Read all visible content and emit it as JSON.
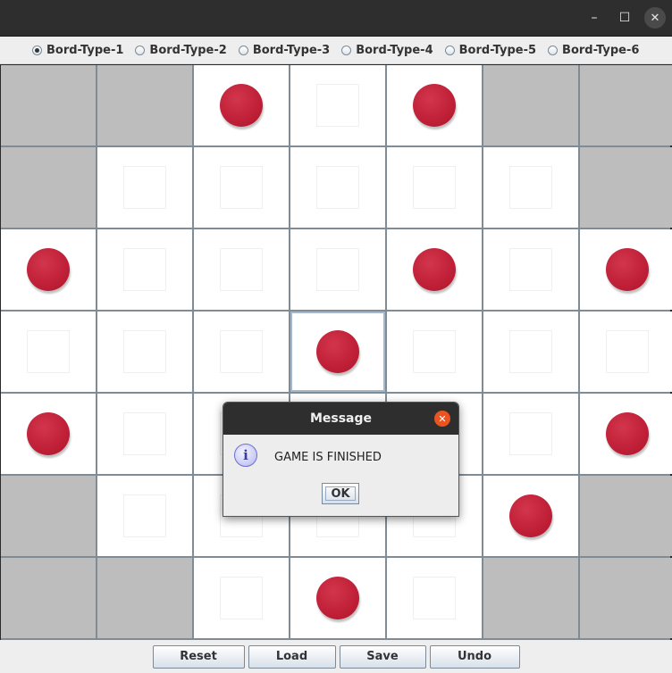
{
  "window": {
    "minimize_glyph": "–",
    "maximize_glyph": "☐",
    "close_glyph": "✕"
  },
  "board_types": [
    {
      "label": "Bord-Type-1",
      "checked": true
    },
    {
      "label": "Bord-Type-2",
      "checked": false
    },
    {
      "label": "Bord-Type-3",
      "checked": false
    },
    {
      "label": "Bord-Type-4",
      "checked": false
    },
    {
      "label": "Bord-Type-5",
      "checked": false
    },
    {
      "label": "Bord-Type-6",
      "checked": false
    }
  ],
  "board": {
    "legend": {
      "B": "blocked",
      "P": "peg",
      "E": "empty"
    },
    "rows": [
      "BBPEPBB",
      "BEEEEEB",
      "PEEEPEP",
      "EEEPEEE",
      "PEEEEEP",
      "BEEEEPB",
      "BBEPEBB"
    ],
    "selected": {
      "row": 3,
      "col": 3
    },
    "colors": {
      "peg": "#bf1f37",
      "blocked": "#bdbdbd",
      "open": "#ffffff",
      "grid": "#7f8b95"
    }
  },
  "buttons": {
    "reset": "Reset",
    "load": "Load",
    "save": "Save",
    "undo": "Undo"
  },
  "dialog": {
    "title": "Message",
    "message": "GAME IS FINISHED",
    "ok": "OK",
    "icon": "info-icon",
    "close_glyph": "✕"
  }
}
